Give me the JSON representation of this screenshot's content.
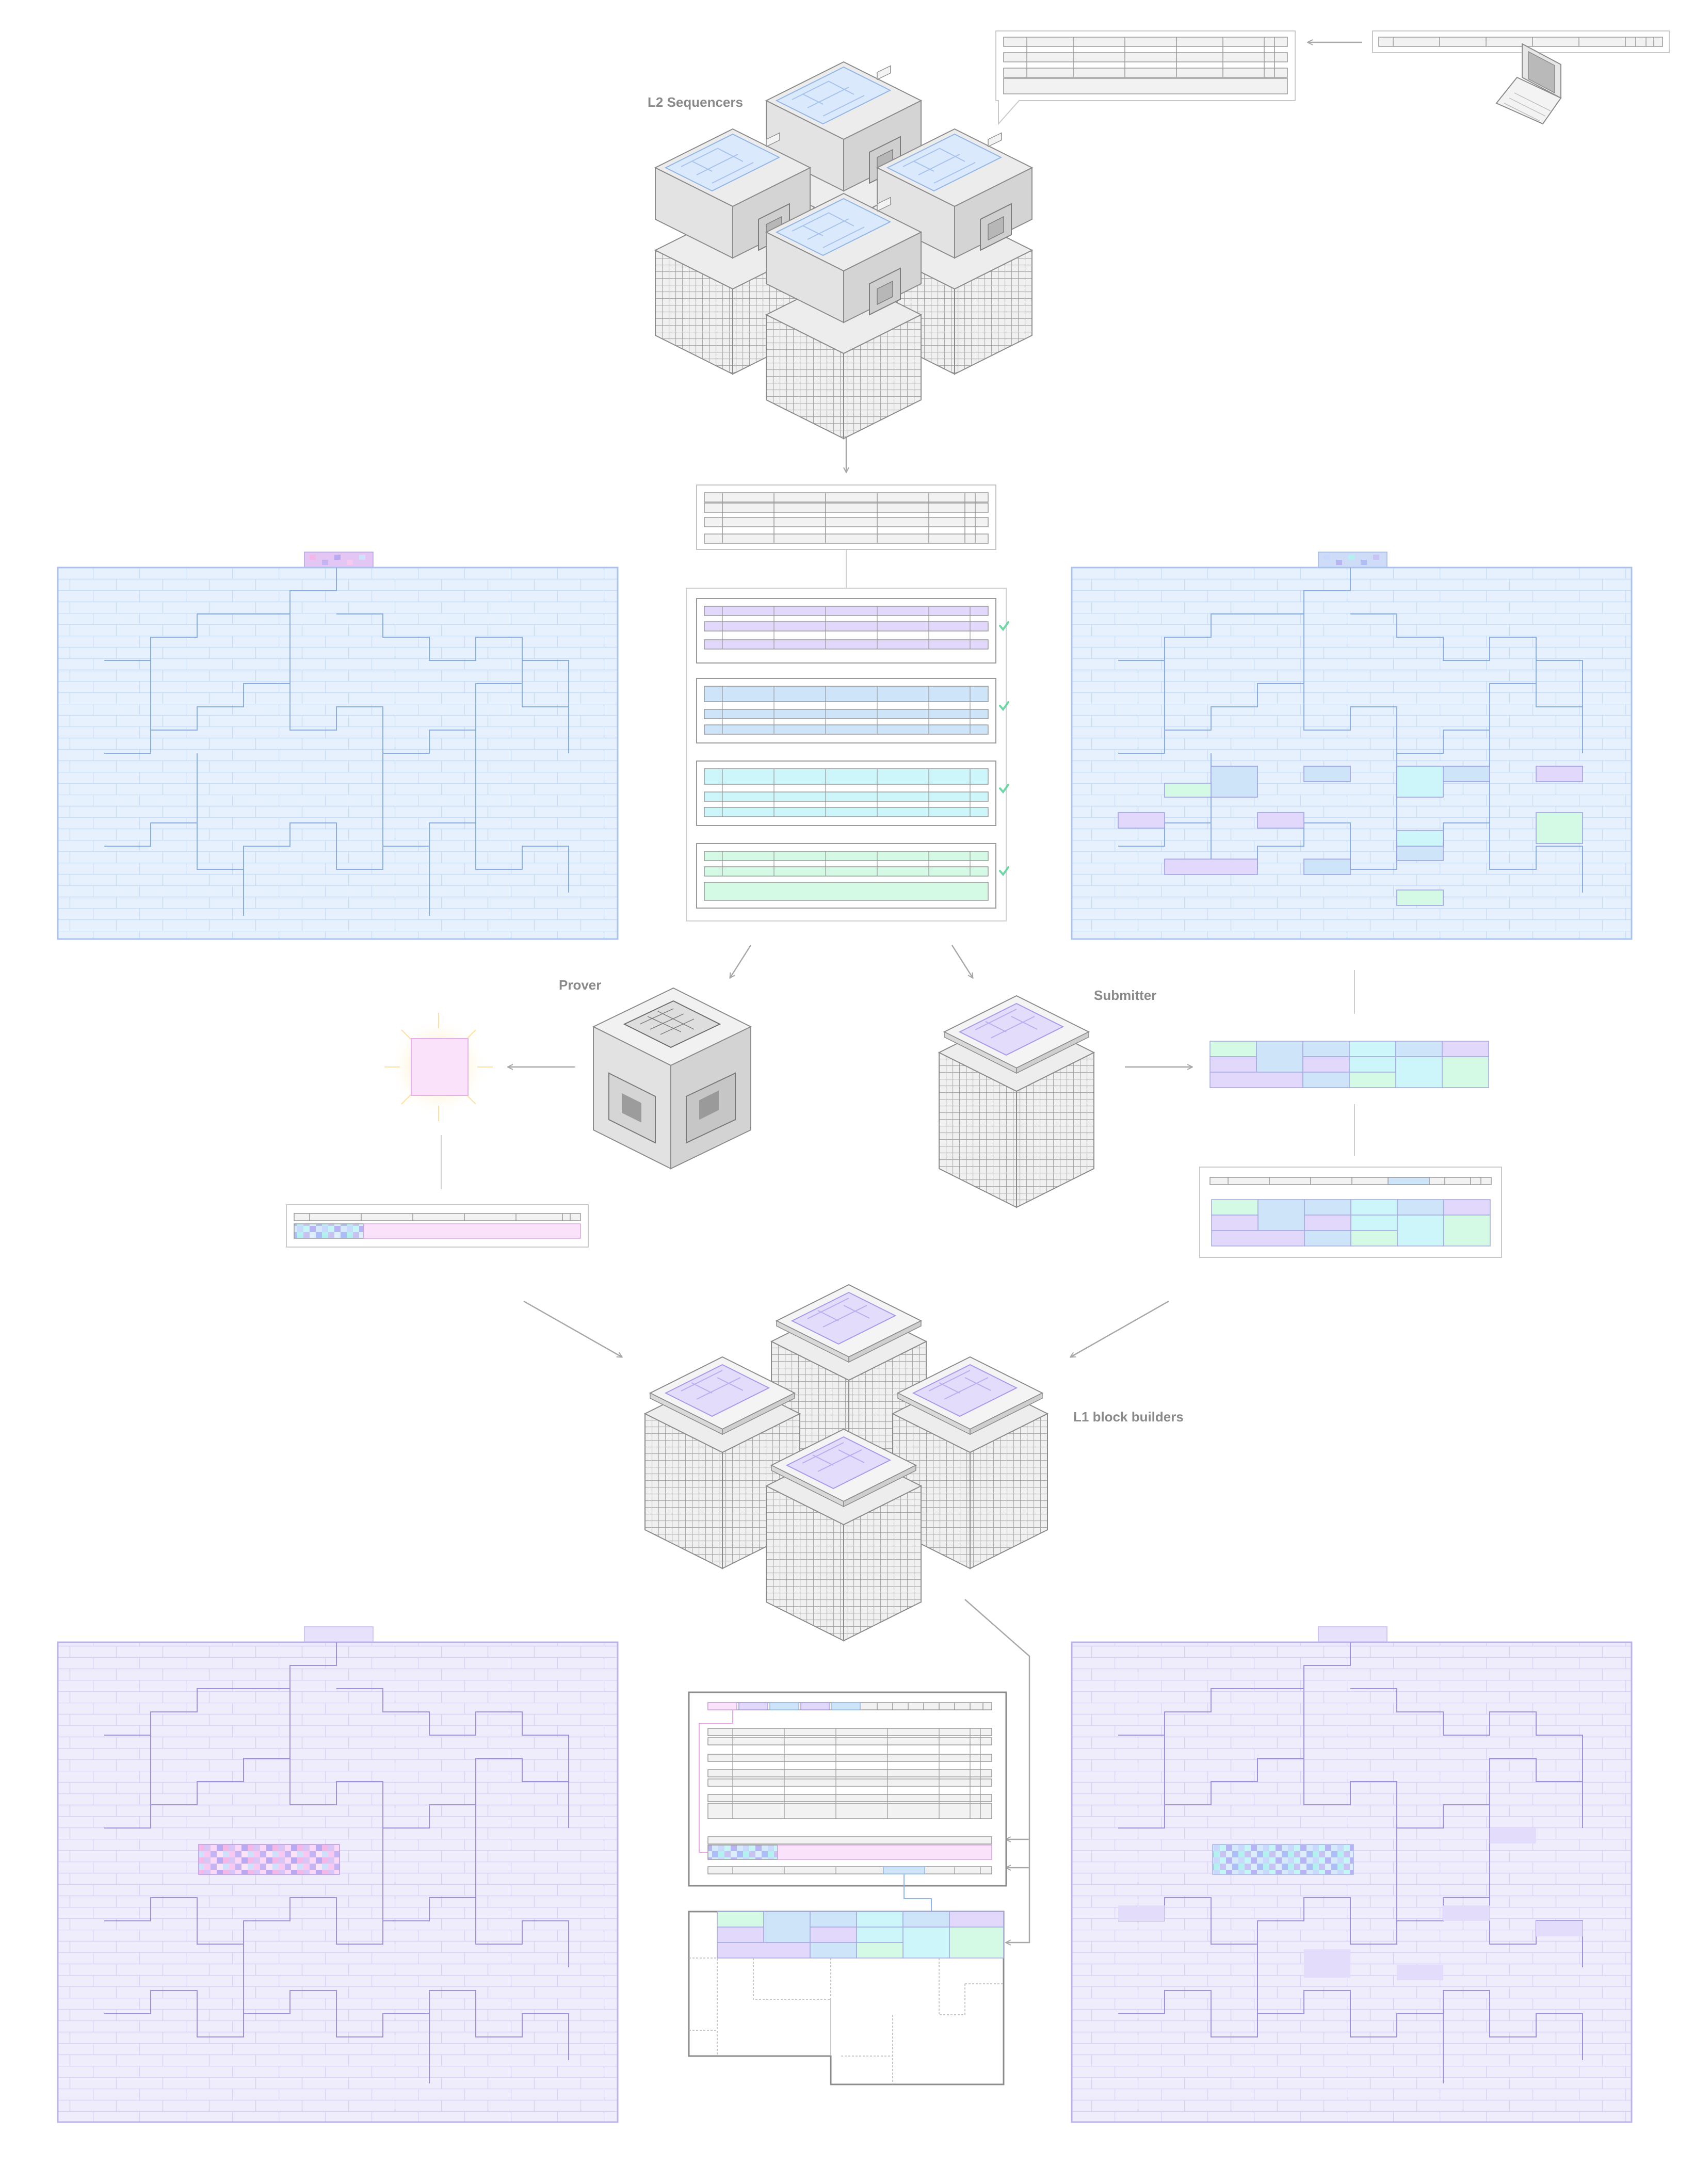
{
  "labels": {
    "sequencers": "L2 Sequencers",
    "prover": "Prover",
    "submitter": "Submitter",
    "builders": "L1 block builders"
  },
  "colors": {
    "l2_grid_fill": "#e6f1fd",
    "l2_grid_line": "#b8cff0",
    "l1_grid_fill": "#efedfb",
    "l1_grid_line": "#cbc3f0",
    "purple": "#e2d8fb",
    "blue": "#cde4f9",
    "cyan": "#cdf6fa",
    "mint": "#d4f9e5",
    "pink": "#fbe2fb",
    "check": "#6fd7a6",
    "arrow": "#a8a8a8",
    "machine": "#e2e2e2",
    "machine_stroke": "#8c8c8c"
  },
  "icons": [
    "server-icon",
    "laptop-icon",
    "prover-cube-icon",
    "checkmark-icon",
    "proof-glow-icon",
    "arrow-icon"
  ]
}
